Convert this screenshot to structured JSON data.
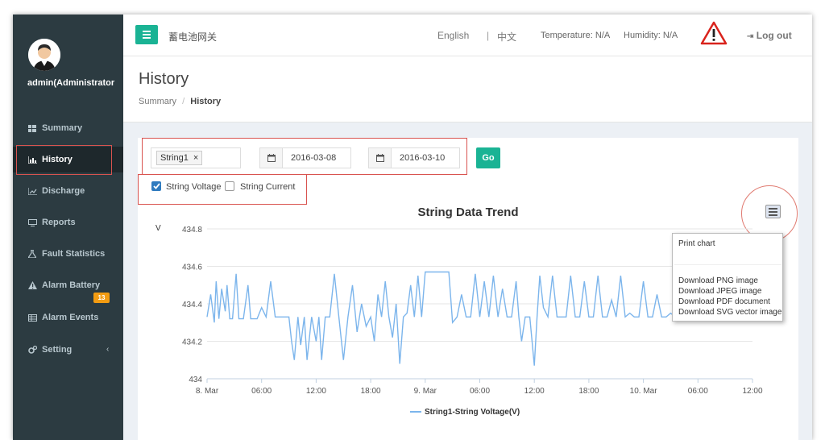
{
  "user": {
    "name": "admin(Administrator"
  },
  "sidebar": {
    "items": [
      {
        "label": "Summary",
        "icon": "dashboard-icon"
      },
      {
        "label": "History",
        "icon": "area-chart-icon"
      },
      {
        "label": "Discharge",
        "icon": "line-chart-icon"
      },
      {
        "label": "Reports",
        "icon": "monitor-icon"
      },
      {
        "label": "Fault Statistics",
        "icon": "flask-icon"
      },
      {
        "label": "Alarm Battery",
        "icon": "warning-icon",
        "badge": "13"
      },
      {
        "label": "Alarm Events",
        "icon": "table-icon"
      },
      {
        "label": "Setting",
        "icon": "cogs-icon"
      }
    ]
  },
  "header": {
    "app_title": "蓄电池网关",
    "lang_en": "English",
    "separator": "|",
    "lang_zh": "中文",
    "temperature": "Temperature: N/A",
    "humidity": "Humidity: N/A",
    "logout": "Log out"
  },
  "page": {
    "title": "History",
    "breadcrumb": {
      "root": "Summary",
      "divider": "/",
      "current": "History"
    }
  },
  "filters": {
    "string_tag": "String1",
    "remove_glyph": "×",
    "start_date": "2016-03-08",
    "end_date": "2016-03-10",
    "go_label": "Go",
    "voltage_label": "String Voltage",
    "voltage_checked": true,
    "current_label": "String Current",
    "current_checked": false
  },
  "export_menu": {
    "print": "Print chart",
    "png": "Download PNG image",
    "jpeg": "Download JPEG image",
    "pdf": "Download PDF document",
    "svg": "Download SVG vector image"
  },
  "colors": {
    "accent": "#1ab394",
    "series": "#7cb5ec",
    "sidebar": "#2c3b41",
    "highlight": "#d9534f"
  },
  "chart_data": {
    "type": "line",
    "title": "String Data Trend",
    "ylabel": "V",
    "ylim": [
      434,
      434.8
    ],
    "yticks": [
      "434",
      "434.2",
      "434.4",
      "434.6",
      "434.8"
    ],
    "xticks": [
      "8. Mar",
      "06:00",
      "12:00",
      "18:00",
      "9. Mar",
      "06:00",
      "12:00",
      "18:00",
      "10. Mar",
      "06:00",
      "12:00"
    ],
    "xlim_hours": [
      0,
      60
    ],
    "grid": true,
    "legend": "bottom-center",
    "series": [
      {
        "name": "String1-String Voltage(V)",
        "x_hours": [
          0.0,
          0.4,
          0.8,
          1.0,
          1.3,
          1.6,
          2.0,
          2.2,
          2.5,
          2.8,
          3.2,
          3.5,
          4.0,
          4.5,
          4.8,
          5.0,
          5.5,
          6.0,
          6.5,
          7.0,
          7.5,
          8.0,
          8.5,
          9.0,
          9.3,
          9.6,
          10.0,
          10.3,
          10.7,
          11.0,
          11.5,
          12.0,
          12.3,
          12.6,
          13.0,
          13.5,
          14.0,
          14.5,
          15.0,
          15.5,
          16.0,
          16.5,
          17.0,
          17.5,
          18.0,
          18.4,
          18.8,
          19.2,
          19.6,
          20.0,
          20.4,
          20.8,
          21.2,
          21.6,
          22.0,
          22.4,
          22.8,
          23.2,
          23.6,
          24.0,
          24.5,
          25.0,
          25.5,
          26.0,
          26.3,
          26.6,
          27.0,
          27.5,
          28.0,
          28.5,
          29.0,
          29.5,
          30.0,
          30.5,
          31.0,
          31.5,
          32.0,
          32.5,
          33.0,
          33.5,
          34.0,
          34.3,
          34.6,
          35.0,
          35.5,
          36.0,
          36.3,
          36.6,
          37.0,
          37.5,
          38.0,
          38.5,
          39.0,
          39.5,
          40.0,
          40.5,
          41.0,
          41.5,
          42.0,
          42.5,
          43.0,
          43.5,
          44.0,
          44.5,
          45.0,
          45.5,
          46.0,
          46.5,
          47.0,
          47.5,
          48.0,
          48.5,
          49.0,
          49.5,
          50.0,
          50.5,
          51.0,
          51.5,
          52.0,
          52.5,
          53.0,
          53.5,
          54.0,
          54.5,
          55.0,
          55.5,
          56.0,
          56.5,
          57.0,
          57.5,
          58.0,
          58.5,
          59.0,
          60.0
        ],
        "values": [
          434.33,
          434.45,
          434.3,
          434.52,
          434.32,
          434.48,
          434.36,
          434.5,
          434.32,
          434.32,
          434.56,
          434.32,
          434.32,
          434.5,
          434.32,
          434.32,
          434.32,
          434.38,
          434.33,
          434.52,
          434.33,
          434.33,
          434.33,
          434.33,
          434.2,
          434.1,
          434.33,
          434.18,
          434.33,
          434.1,
          434.33,
          434.2,
          434.33,
          434.1,
          434.33,
          434.33,
          434.56,
          434.33,
          434.1,
          434.33,
          434.5,
          434.25,
          434.4,
          434.28,
          434.33,
          434.2,
          434.45,
          434.33,
          434.52,
          434.33,
          434.22,
          434.4,
          434.08,
          434.33,
          434.35,
          434.5,
          434.33,
          434.55,
          434.33,
          434.57,
          434.57,
          434.57,
          434.57,
          434.57,
          434.57,
          434.57,
          434.3,
          434.33,
          434.45,
          434.33,
          434.33,
          434.56,
          434.33,
          434.52,
          434.33,
          434.55,
          434.33,
          434.48,
          434.33,
          434.33,
          434.52,
          434.33,
          434.2,
          434.33,
          434.33,
          434.07,
          434.33,
          434.55,
          434.38,
          434.33,
          434.55,
          434.33,
          434.33,
          434.33,
          434.55,
          434.33,
          434.33,
          434.52,
          434.33,
          434.33,
          434.55,
          434.33,
          434.33,
          434.42,
          434.33,
          434.55,
          434.33,
          434.35,
          434.33,
          434.33,
          434.52,
          434.33,
          434.33,
          434.45,
          434.33,
          434.33,
          434.35,
          434.33,
          434.55,
          434.33,
          434.33,
          434.5,
          434.33,
          434.33,
          434.52,
          434.33,
          434.33,
          434.33,
          434.33,
          434.55,
          434.33,
          434.33,
          434.33,
          434.33
        ]
      }
    ]
  }
}
